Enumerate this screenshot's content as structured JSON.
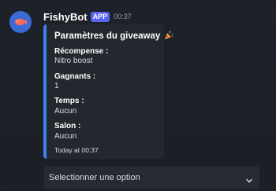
{
  "message": {
    "author": "FishyBot",
    "badge": "APP",
    "time": "00:37",
    "avatar_icon": "fish-icon"
  },
  "embed": {
    "accent_color": "#3f7ff0",
    "title": "Paramètres du giveaway",
    "title_icon": "party-popper-icon",
    "fields": [
      {
        "name": "Récompense :",
        "value": "Nitro boost"
      },
      {
        "name": "Gagnants :",
        "value": "1"
      },
      {
        "name": "Temps :",
        "value": "Aucun"
      },
      {
        "name": "Salon :",
        "value": "Aucun"
      }
    ],
    "footer": "Today at 00:37"
  },
  "select": {
    "placeholder": "Selectionner une option",
    "icon": "chevron-down-icon"
  }
}
